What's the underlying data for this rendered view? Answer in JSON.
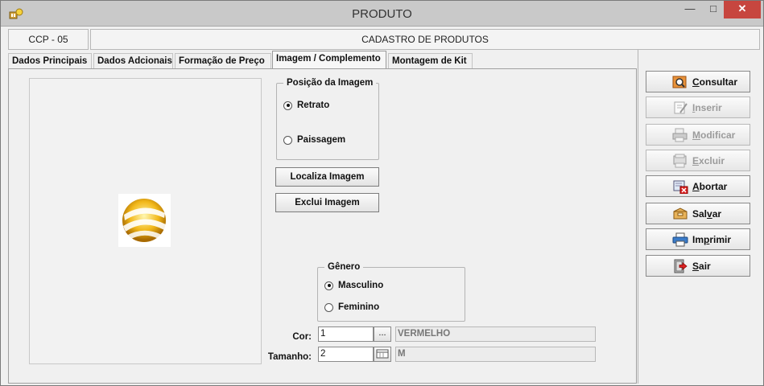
{
  "window": {
    "title": "PRODUTO"
  },
  "header": {
    "code": "CCP - 05",
    "title": "CADASTRO DE PRODUTOS"
  },
  "tabs": [
    {
      "label": "Dados Principais"
    },
    {
      "label": "Dados Adcionais"
    },
    {
      "label": "Formação de Preço"
    },
    {
      "label": "Imagem / Complemento",
      "active": true
    },
    {
      "label": "Montagem de Kit"
    }
  ],
  "image_position": {
    "legend": "Posição da Imagem",
    "options": [
      {
        "label": "Retrato",
        "selected": true
      },
      {
        "label": "Paissagem",
        "selected": false
      }
    ]
  },
  "image_buttons": {
    "locate": "Localiza Imagem",
    "delete": "Exclui Imagem"
  },
  "gender": {
    "legend": "Gênero",
    "options": [
      {
        "label": "Masculino",
        "selected": true
      },
      {
        "label": "Feminino",
        "selected": false
      }
    ]
  },
  "fields": {
    "cor": {
      "label": "Cor:",
      "value": "1",
      "description": "VERMELHO",
      "lookup_label": "..."
    },
    "tamanho": {
      "label": "Tamanho:",
      "value": "2",
      "description": "M"
    }
  },
  "actions": [
    {
      "first": "C",
      "rest": "onsultar",
      "pre": "",
      "enabled": true,
      "icon": "search-icon"
    },
    {
      "first": "I",
      "rest": "nserir",
      "pre": "",
      "enabled": false,
      "icon": "edit-icon"
    },
    {
      "first": "M",
      "rest": "odificar",
      "pre": "",
      "enabled": false,
      "icon": "printer-modify-icon"
    },
    {
      "first": "E",
      "rest": "xcluir",
      "pre": "",
      "enabled": false,
      "icon": "delete-icon"
    },
    {
      "first": "A",
      "rest": "bortar",
      "pre": "",
      "enabled": true,
      "icon": "abort-icon"
    },
    {
      "pre": "Sal",
      "first": "v",
      "rest": "ar",
      "enabled": true,
      "icon": "save-box-icon"
    },
    {
      "pre": "Im",
      "first": "p",
      "rest": "rimir",
      "enabled": true,
      "icon": "print-icon"
    },
    {
      "first": "S",
      "rest": "air",
      "pre": "",
      "enabled": true,
      "icon": "exit-door-icon"
    }
  ],
  "colors": {
    "close_button": "#c7463f",
    "titlebar": "#c9c9c9",
    "disabled_text": "#9b9b9b"
  }
}
